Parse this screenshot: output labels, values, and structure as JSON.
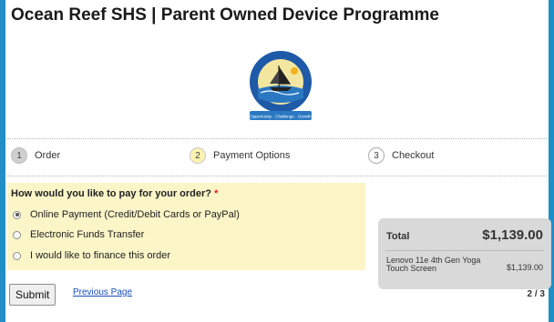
{
  "page": {
    "title": "Ocean Reef SHS | Parent Owned Device Programme",
    "logo_motto": "Opportunity · Challenge · Growth"
  },
  "steps": [
    {
      "number": "1",
      "label": "Order",
      "state": "done"
    },
    {
      "number": "2",
      "label": "Payment Options",
      "state": "active"
    },
    {
      "number": "3",
      "label": "Checkout",
      "state": "todo"
    }
  ],
  "form": {
    "question": "How would you like to pay for your order?",
    "required_marker": "*",
    "options": [
      {
        "label": "Online Payment (Credit/Debit Cards or PayPal)",
        "selected": true
      },
      {
        "label": "Electronic Funds Transfer",
        "selected": false
      },
      {
        "label": "I would like to finance this order",
        "selected": false
      }
    ],
    "submit_label": "Submit",
    "previous_label": "Previous Page"
  },
  "summary": {
    "total_label": "Total",
    "total_amount": "$1,139.00",
    "item_name": "Lenovo 11e 4th Gen Yoga Touch Screen",
    "item_price": "$1,139.00",
    "page_indicator": "2 / 3"
  },
  "colors": {
    "frame_border": "#1f8fc8",
    "question_bg": "#fbf5c8",
    "summary_bg": "#d9d9d9",
    "link": "#1a4db8",
    "required": "#d22222"
  }
}
